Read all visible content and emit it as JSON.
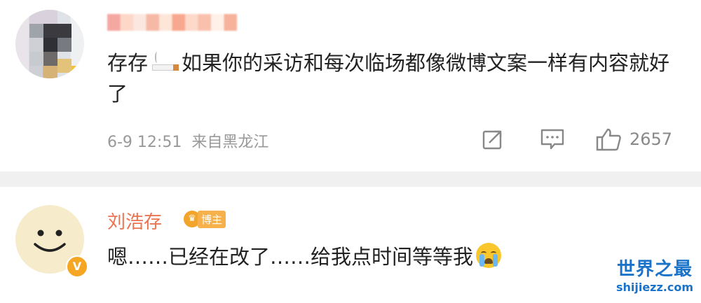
{
  "comment1": {
    "text_before": "存存",
    "text_after": "如果你的采访和每次临场都像微博文案一样有内容就好了",
    "emoji": "cigarette-emoji",
    "date": "6-9 12:51",
    "source": "来自黑龙江",
    "like_count": "2657"
  },
  "comment2": {
    "author": "刘浩存",
    "badge_label": "博主",
    "verified": "V",
    "text": "嗯……已经在改了……给我点时间等等我",
    "emoji": "crying-face-emoji"
  },
  "watermark": {
    "title": "世界之最",
    "url": "shijiezz.com"
  },
  "colors": {
    "author_name": "#eb7350",
    "meta_text": "#999999",
    "separator": "#f0f0f0",
    "watermark": "#1a73c9"
  }
}
